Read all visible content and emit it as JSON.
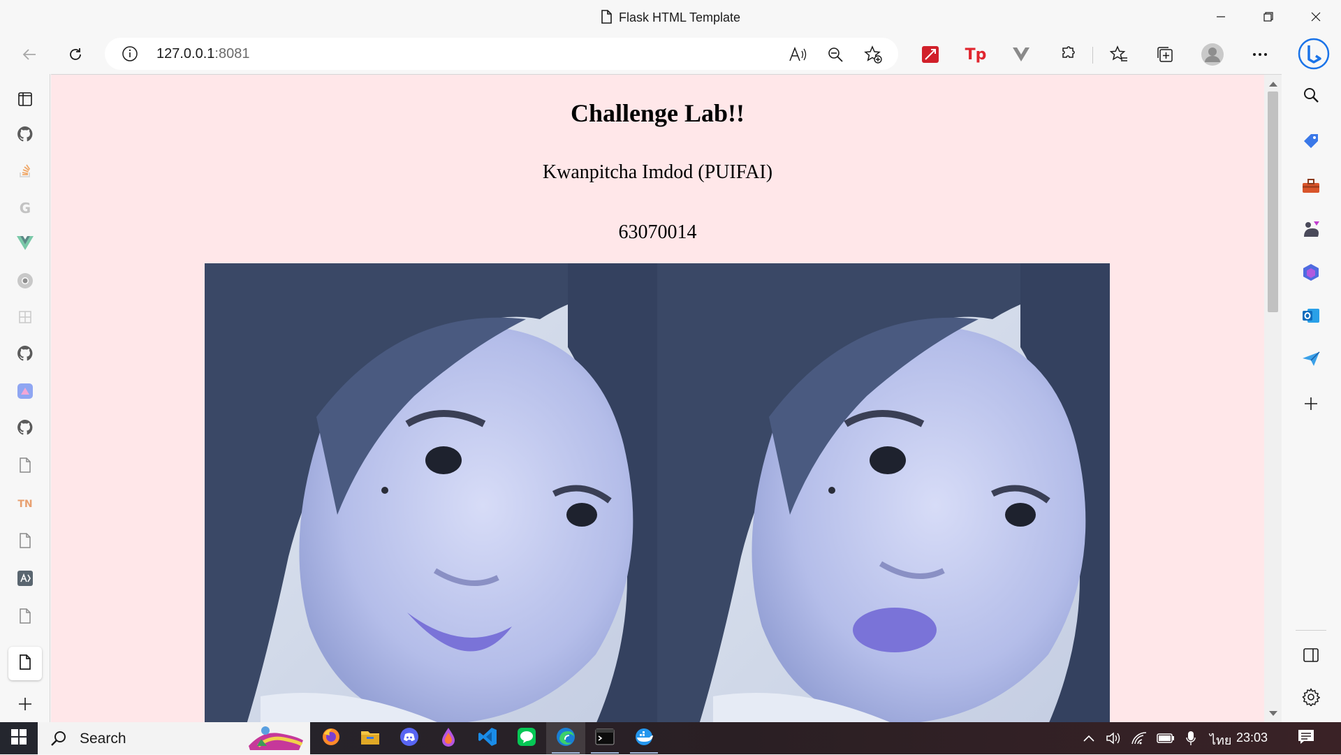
{
  "window": {
    "title": "Flask HTML Template"
  },
  "toolbar": {
    "url_host": "127.0.0.1",
    "url_port": ":8081"
  },
  "page": {
    "heading": "Challenge Lab!!",
    "name": "Kwanpitcha Imdod (PUIFAI)",
    "student_id": "63070014",
    "background": "#ffe7e9",
    "images": [
      {
        "label": "photo-left"
      },
      {
        "label": "photo-right"
      }
    ]
  },
  "vertical_tabs": [
    "tab-actions-icon",
    "github-icon",
    "stackoverflow-icon",
    "google-icon",
    "vue-icon",
    "chrome-icon",
    "extension-icon",
    "github-icon",
    "app-icon",
    "github-icon",
    "document-icon",
    "tn-icon",
    "document-icon",
    "aws-icon",
    "document-icon",
    "document-icon"
  ],
  "vertical_tabs_tn_text": "TN",
  "right_sidebar": [
    "search-icon",
    "tag-icon",
    "toolbox-icon",
    "games-icon",
    "office-icon",
    "outlook-icon",
    "send-icon",
    "add-icon"
  ],
  "taskbar": {
    "search_label": "Search",
    "language": "ไทย",
    "time": "23:03",
    "apps": [
      "firefox-icon",
      "file-explorer-icon",
      "discord-icon",
      "drop-icon",
      "vscode-icon",
      "line-icon",
      "edge-icon",
      "terminal-icon",
      "docker-icon"
    ]
  },
  "colors": {
    "accent_blue": "#0067c0",
    "page_pink": "#ffe7e9"
  }
}
